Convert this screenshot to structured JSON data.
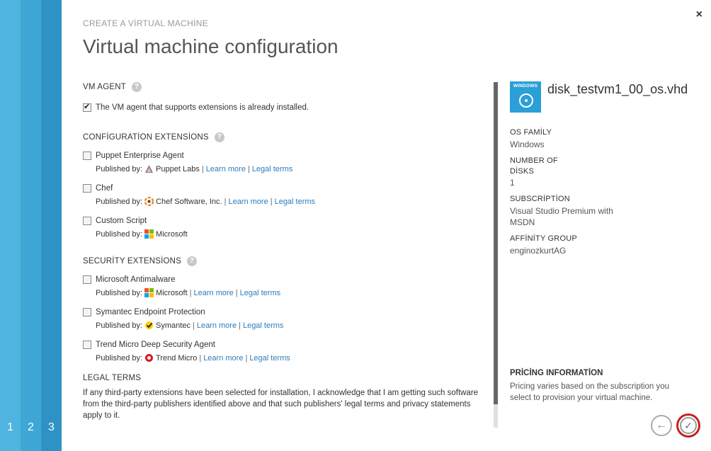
{
  "steps": [
    "1",
    "2",
    "3"
  ],
  "header": {
    "crumb": "CREATE A VİRTUAL MACHİNE",
    "title": "Virtual machine configuration",
    "close": "×"
  },
  "vm_agent": {
    "heading": "VM AGENT",
    "checkbox_label": "The VM agent that supports extensions is already installed.",
    "checked": true
  },
  "config_extensions": {
    "heading": "CONFİGURATİON EXTENSİONS",
    "items": [
      {
        "label": "Puppet Enterprise Agent",
        "published_by": "Published by:",
        "publisher": "Puppet Labs",
        "learn_more": "Learn more",
        "legal": "Legal terms"
      },
      {
        "label": "Chef",
        "published_by": "Published by:",
        "publisher": "Chef Software, Inc.",
        "learn_more": "Learn more",
        "legal": "Legal terms"
      },
      {
        "label": "Custom Script",
        "published_by": "Published by:",
        "publisher": "Microsoft"
      }
    ]
  },
  "security_extensions": {
    "heading": "SECURİTY EXTENSİONS",
    "items": [
      {
        "label": "Microsoft Antimalware",
        "published_by": "Published by:",
        "publisher": "Microsoft",
        "learn_more": "Learn more",
        "legal": "Legal terms"
      },
      {
        "label": "Symantec Endpoint Protection",
        "published_by": "Published by:",
        "publisher": "Symantec",
        "learn_more": "Learn more",
        "legal": "Legal terms"
      },
      {
        "label": "Trend Micro Deep Security Agent",
        "published_by": "Published by:",
        "publisher": "Trend Micro",
        "learn_more": "Learn more",
        "legal": "Legal terms"
      }
    ]
  },
  "legal_terms": {
    "heading": "LEGAL TERMS",
    "text": "If any third-party extensions have been selected for installation, I acknowledge that I am getting such software from the third-party publishers identified above and that such publishers' legal terms and privacy statements apply to it."
  },
  "summary": {
    "icon_label": "WINDOWS",
    "disk_name": "disk_testvm1_00_os.vhd",
    "os_family_label": "OS FAMİLY",
    "os_family": "Windows",
    "disks_label_1": "NUMBER OF",
    "disks_label_2": "DİSKS",
    "disks": "1",
    "subscription_label": "SUBSCRİPTİON",
    "subscription_1": "Visual Studio Premium with",
    "subscription_2": "MSDN",
    "affinity_label": "AFFİNİTY GROUP",
    "affinity": "enginozkurtAG"
  },
  "pricing": {
    "heading": "PRİCİNG INFORMATİON",
    "text": "Pricing varies based on the subscription you select to provision your virtual machine."
  },
  "buttons": {
    "back": "←",
    "ok": "✓"
  },
  "help_glyph": "?"
}
